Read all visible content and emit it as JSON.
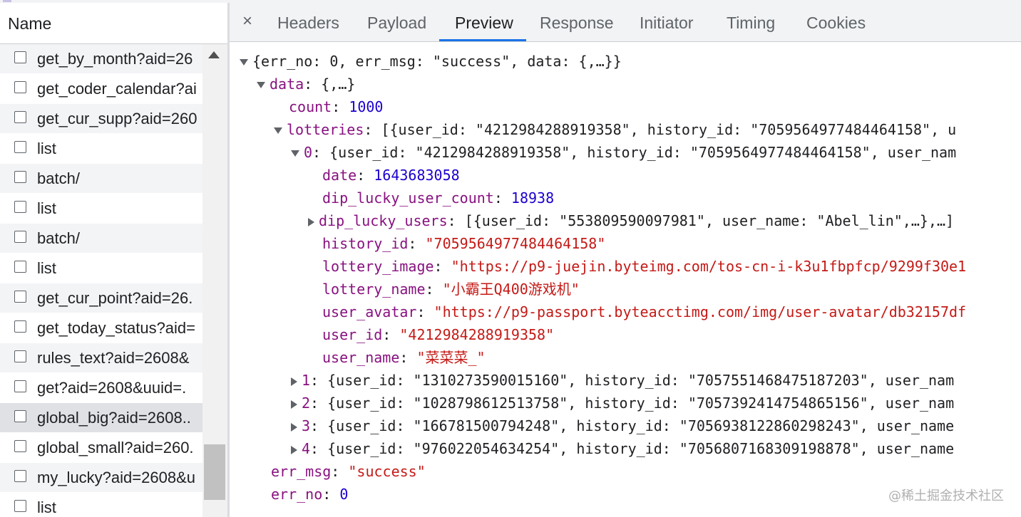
{
  "left_panel": {
    "header": "Name",
    "requests": [
      "get_by_month?aid=26",
      "get_coder_calendar?ai",
      "get_cur_supp?aid=260",
      "list",
      "batch/",
      "list",
      "batch/",
      "list",
      "get_cur_point?aid=26.",
      "get_today_status?aid=",
      "rules_text?aid=2608&",
      "get?aid=2608&uuid=.",
      "global_big?aid=2608..",
      "global_small?aid=260.",
      "my_lucky?aid=2608&u",
      "list"
    ]
  },
  "tabs": {
    "close": "×",
    "items": [
      "Headers",
      "Payload",
      "Preview",
      "Response",
      "Initiator",
      "Timing",
      "Cookies"
    ],
    "active": "Preview"
  },
  "preview": {
    "root": "{err_no: 0, err_msg: \"success\", data: {,…}}",
    "data_key": "data",
    "data_summary": ": {,…}",
    "count_key": "count",
    "count_val": "1000",
    "lotteries_key": "lotteries",
    "lotteries_summary": ": [{user_id: \"4212984288919358\", history_id: \"7059564977484464158\", u",
    "item0_key": "0",
    "item0_summary": ": {user_id: \"4212984288919358\", history_id: \"7059564977484464158\", user_nam",
    "fields": [
      {
        "key": "date",
        "val": "1643683058",
        "kind": "n"
      },
      {
        "key": "dip_lucky_user_count",
        "val": "18938",
        "kind": "n"
      },
      {
        "key": "dip_lucky_users",
        "val": "[{user_id: \"553809590097981\", user_name: \"Abel_lin\",…},…]",
        "kind": "p"
      },
      {
        "key": "history_id",
        "val": "\"7059564977484464158\"",
        "kind": "s"
      },
      {
        "key": "lottery_image",
        "val": "\"https://p9-juejin.byteimg.com/tos-cn-i-k3u1fbpfcp/9299f30e1",
        "kind": "s"
      },
      {
        "key": "lottery_name",
        "val": "\"小霸王Q400游戏机\"",
        "kind": "s"
      },
      {
        "key": "user_avatar",
        "val": "\"https://p9-passport.byteacctimg.com/img/user-avatar/db32157df",
        "kind": "s"
      },
      {
        "key": "user_id",
        "val": "\"4212984288919358\"",
        "kind": "s"
      },
      {
        "key": "user_name",
        "val": "\"菜菜菜_\"",
        "kind": "s"
      }
    ],
    "collapsed_items": [
      {
        "key": "1",
        "summary": ": {user_id: \"1310273590015160\", history_id: \"7057551468475187203\", user_nam"
      },
      {
        "key": "2",
        "summary": ": {user_id: \"1028798612513758\", history_id: \"7057392414754865156\", user_nam"
      },
      {
        "key": "3",
        "summary": ": {user_id: \"166781500794248\", history_id: \"7056938122860298243\", user_name"
      },
      {
        "key": "4",
        "summary": ": {user_id: \"976022054634254\", history_id: \"7056807168309198878\", user_name"
      }
    ],
    "err_msg_key": "err_msg",
    "err_msg_val": "\"success\"",
    "err_no_key": "err_no",
    "err_no_val": "0"
  },
  "watermark": "@稀土掘金技术社区"
}
